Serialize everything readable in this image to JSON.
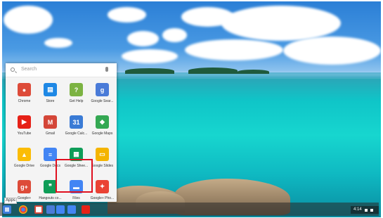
{
  "launcher": {
    "search_placeholder": "Search",
    "apps": [
      {
        "label": "Chrome",
        "icon": "chrome-icon",
        "color": "#dd4b39"
      },
      {
        "label": "Store",
        "icon": "store-icon",
        "color": "#1e88e5"
      },
      {
        "label": "Get Help",
        "icon": "get-help-icon",
        "color": "#7cb342"
      },
      {
        "label": "Google Sear...",
        "icon": "google-search-icon",
        "color": "#4a7bd8"
      },
      {
        "label": "YouTube",
        "icon": "youtube-icon",
        "color": "#e62117"
      },
      {
        "label": "Gmail",
        "icon": "gmail-icon",
        "color": "#d44638"
      },
      {
        "label": "Google Calc...",
        "icon": "google-calculator-icon",
        "color": "#3a7bd5"
      },
      {
        "label": "Google Maps",
        "icon": "google-maps-icon",
        "color": "#34a853"
      },
      {
        "label": "Google Drive",
        "icon": "google-drive-icon",
        "color": "#fbbc05"
      },
      {
        "label": "Google Docs",
        "icon": "google-docs-icon",
        "color": "#4285f4"
      },
      {
        "label": "Google Shee...",
        "icon": "google-sheets-icon",
        "color": "#0f9d58"
      },
      {
        "label": "Google Slides",
        "icon": "google-slides-icon",
        "color": "#f4b400"
      },
      {
        "label": "Google+",
        "icon": "google-plus-icon",
        "color": "#dd4b39"
      },
      {
        "label": "Hangouts co...",
        "icon": "hangouts-icon",
        "color": "#0f9d58"
      },
      {
        "label": "Files",
        "icon": "files-icon",
        "color": "#4285f4"
      },
      {
        "label": "Google+ Pho...",
        "icon": "google-photos-icon",
        "color": "#ea4335"
      }
    ]
  },
  "shelf": {
    "apps_label": "Apps",
    "time": "4:14"
  }
}
